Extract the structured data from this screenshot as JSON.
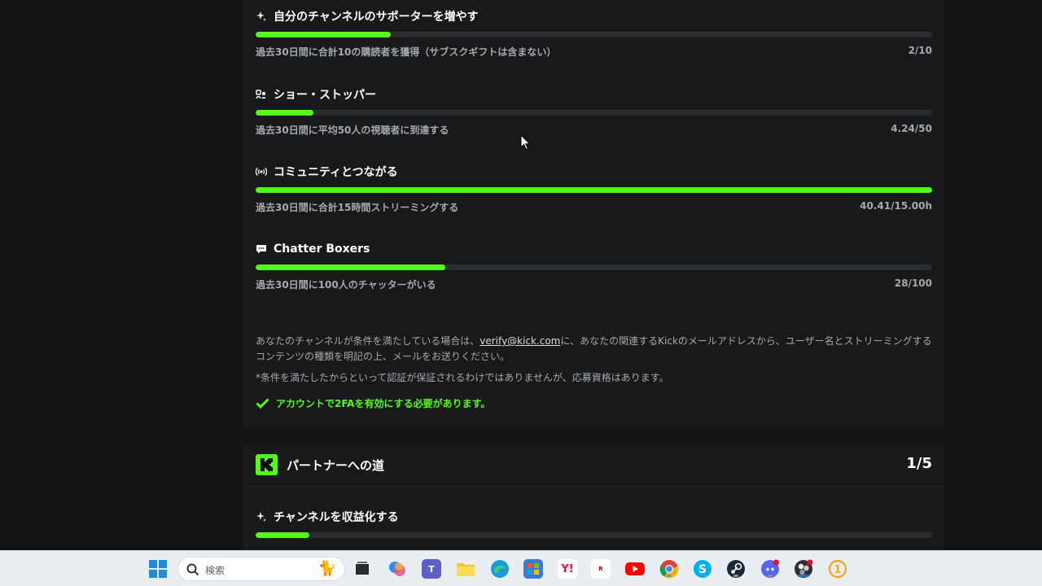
{
  "goals": [
    {
      "icon": "sparkle-icon",
      "title": "自分のチャンネルのサポーターを増やす",
      "description": "過去30日間に合計10の購読者を獲得（サブスクギフトは含まない）",
      "progress_text": "2/10",
      "progress": 0.2
    },
    {
      "icon": "users-icon",
      "title": "ショー・ストッパー",
      "description": "過去30日間に平均50人の視聴者に到達する",
      "progress_text": "4.24/50",
      "progress": 0.085
    },
    {
      "icon": "broadcast-icon",
      "title": "コミュニティとつながる",
      "description": "過去30日間に合計15時間ストリーミングする",
      "progress_text": "40.41/15.00h",
      "progress": 1.0
    },
    {
      "icon": "chat-bubble-icon",
      "title": "Chatter Boxers",
      "description": "過去30日間に100人のチャッターがいる",
      "progress_text": "28/100",
      "progress": 0.28
    }
  ],
  "info": {
    "text_before_link": "あなたのチャンネルが条件を満たしている場合は、",
    "email_link": "verify@kick.com",
    "text_after_link": "に、あなたの関連するKickのメールアドレスから、ユーザー名とストリーミングするコンテンツの種類を明記の上、メールをお送りください。",
    "disclaimer": "*条件を満たしたからといって認証が保証されるわけではありませんが、応募資格はあります。",
    "requirement": "アカウントで2FAを有効にする必要があります。"
  },
  "partner_section": {
    "logo_letter": "K",
    "title": "パートナーへの道",
    "count": "1/5",
    "first_goal": {
      "icon": "sparkle-icon",
      "title": "チャンネルを収益化する",
      "progress": 0.08
    }
  },
  "taskbar": {
    "search_placeholder": "検索",
    "apps": [
      "start-icon",
      "task-view-icon",
      "copilot-icon",
      "teams-icon",
      "file-explorer-icon",
      "edge-icon",
      "store-icon",
      "yahoo-icon",
      "rakuten-icon",
      "youtube-icon",
      "chrome-icon",
      "skype-icon",
      "steam-icon",
      "discord-icon",
      "obs-icon",
      "app-icon"
    ]
  },
  "colors": {
    "accent": "#53fc18",
    "background": "#111315",
    "panel": "#17191b"
  }
}
